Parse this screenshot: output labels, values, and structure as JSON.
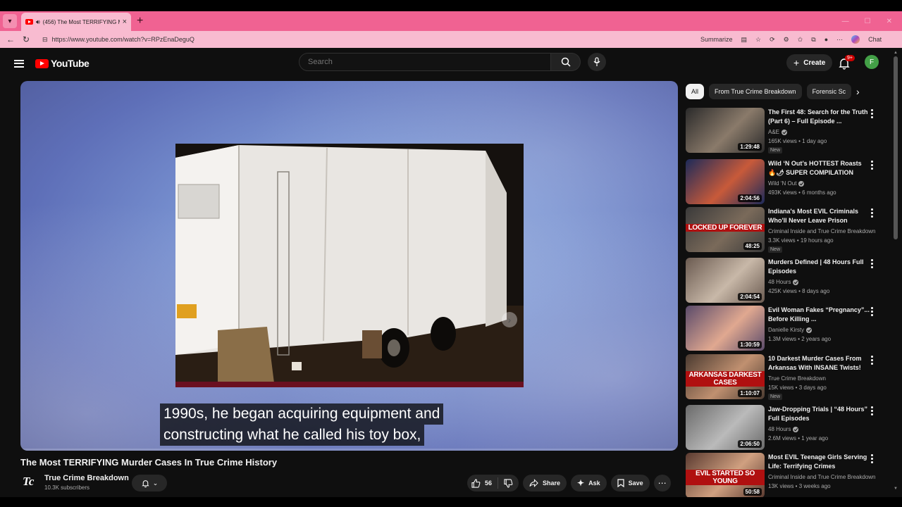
{
  "browser": {
    "tab_title": "(456) The Most TERRIFYING M",
    "url": "https://www.youtube.com/watch?v=RPzEnaDeguQ",
    "summarize_label": "Summarize",
    "chat_label": "Chat"
  },
  "header": {
    "logo_text": "YouTube",
    "search_placeholder": "Search",
    "create_label": "Create",
    "notification_count": "9+",
    "avatar_letter": "F"
  },
  "player": {
    "caption_line1": "1990s, he began acquiring equipment and",
    "caption_line2": "constructing what he called his toy box,"
  },
  "video": {
    "title": "The Most TERRIFYING Murder Cases In True Crime History",
    "channel_name": "True Crime Breakdown",
    "channel_logo": "Tc",
    "subscribers": "10.3K subscribers",
    "like_count": "56",
    "share_label": "Share",
    "ask_label": "Ask",
    "save_label": "Save"
  },
  "chips": [
    "All",
    "From True Crime Breakdown",
    "Forensic Sc"
  ],
  "recommendations": [
    {
      "title": "The First 48: Search for the Truth (Part 6) – Full Episode ...",
      "channel": "A&E",
      "verified": true,
      "meta": "165K views • 1 day ago",
      "new": "New",
      "duration": "1:29:48",
      "banner": "",
      "colors": [
        "#2a2a2a",
        "#8a7a6a"
      ]
    },
    {
      "title": "Wild ‘N Out’s HOTTEST Roasts 🔥🌶 SUPER COMPILATION",
      "channel": "Wild ‘N Out",
      "verified": true,
      "meta": "493K views • 6 months ago",
      "new": "",
      "duration": "2:04:56",
      "banner": "",
      "colors": [
        "#1c2a5a",
        "#c85a3a"
      ]
    },
    {
      "title": "Indiana's Most EVIL Criminals Who'll Never Leave Prison",
      "channel": "Criminal Inside and True Crime Breakdown",
      "verified": false,
      "meta": "3.3K views • 19 hours ago",
      "new": "New",
      "duration": "48:25",
      "banner": "LOCKED UP FOREVER",
      "colors": [
        "#3a3a3a",
        "#7a6a5a"
      ]
    },
    {
      "title": "Murders Defined | 48 Hours Full Episodes",
      "channel": "48 Hours",
      "verified": true,
      "meta": "425K views • 8 days ago",
      "new": "",
      "duration": "2:04:54",
      "banner": "",
      "colors": [
        "#6a5a50",
        "#c8b8a8"
      ]
    },
    {
      "title": "Evil Woman Fakes “Pregnancy”... Before Killing ...",
      "channel": "Danielle Kirsty",
      "verified": true,
      "meta": "1.3M views • 2 years ago",
      "new": "",
      "duration": "1:30:59",
      "banner": "",
      "colors": [
        "#5a4a6a",
        "#e0a890"
      ]
    },
    {
      "title": "10 Darkest Murder Cases From Arkansas With INSANE Twists!",
      "channel": "True Crime Breakdown",
      "verified": false,
      "meta": "15K views • 3 days ago",
      "new": "New",
      "duration": "1:10:07",
      "banner": "ARKANSAS DARKEST CASES",
      "colors": [
        "#4a3a30",
        "#c09070"
      ]
    },
    {
      "title": "Jaw-Dropping Trials | “48 Hours” Full Episodes",
      "channel": "48 Hours",
      "verified": true,
      "meta": "2.6M views • 1 year ago",
      "new": "",
      "duration": "2:06:50",
      "banner": "",
      "colors": [
        "#6a6a6a",
        "#bababa"
      ]
    },
    {
      "title": "Most EVIL Teenage Girls Serving Life: Terrifying Crimes",
      "channel": "Criminal Inside and True Crime Breakdown",
      "verified": false,
      "meta": "13K views • 3 weeks ago",
      "new": "",
      "duration": "50:58",
      "banner": "EVIL STARTED SO YOUNG",
      "colors": [
        "#5a3a30",
        "#d0a080"
      ]
    }
  ]
}
